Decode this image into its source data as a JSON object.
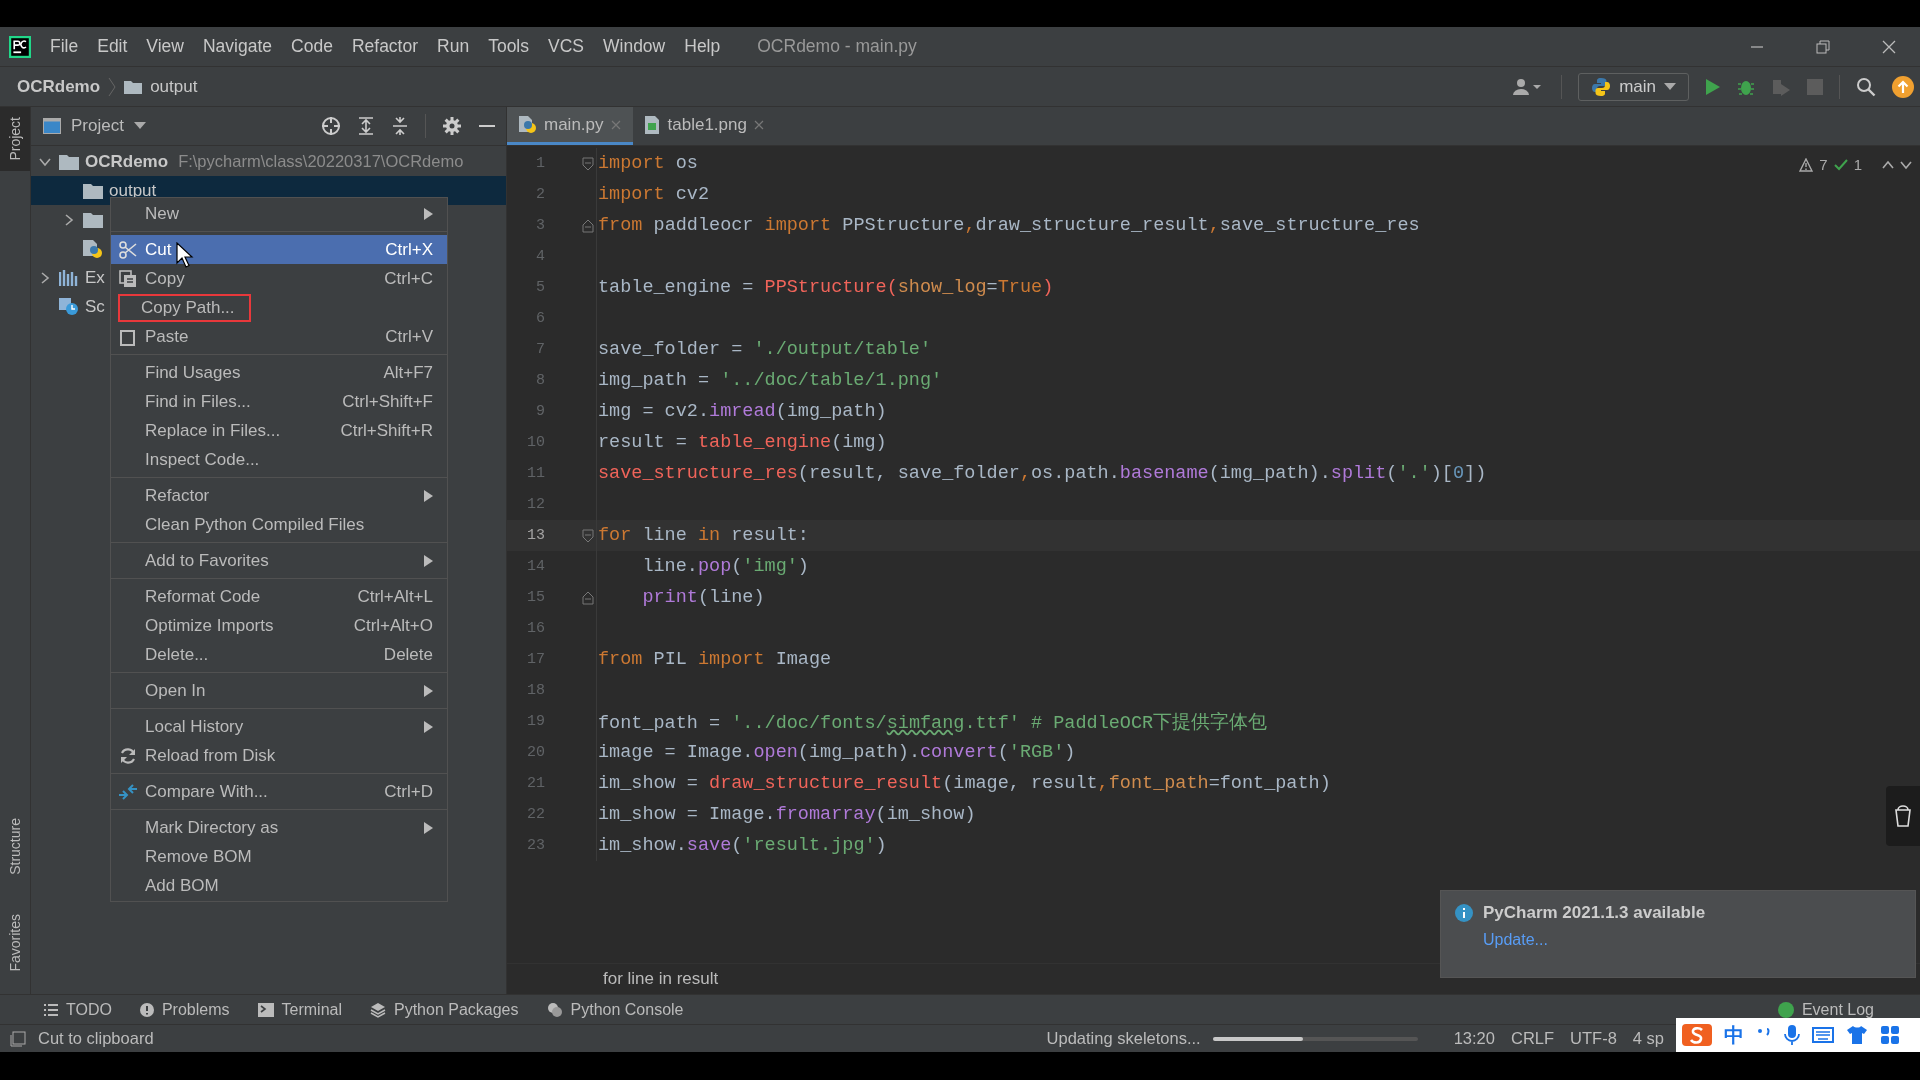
{
  "window": {
    "title": "OCRdemo - main.py"
  },
  "menu_bar": [
    {
      "label": "File"
    },
    {
      "label": "Edit"
    },
    {
      "label": "View"
    },
    {
      "label": "Navigate"
    },
    {
      "label": "Code"
    },
    {
      "label": "Refactor"
    },
    {
      "label": "Run"
    },
    {
      "label": "Tools"
    },
    {
      "label": "VCS"
    },
    {
      "label": "Window"
    },
    {
      "label": "Help"
    }
  ],
  "breadcrumb": [
    {
      "label": "OCRdemo",
      "kind": "project"
    },
    {
      "label": "output",
      "kind": "folder"
    }
  ],
  "run_config": {
    "label": "main"
  },
  "side_stripe": [
    {
      "label": "Project",
      "selected": true
    },
    {
      "label": "Structure",
      "selected": false
    },
    {
      "label": "Favorites",
      "selected": false
    }
  ],
  "project_panel": {
    "title": "Project",
    "tree": [
      {
        "kind": "folder",
        "label": "OCRdemo",
        "path": "F:\\pycharm\\class\\20220317\\OCRdemo",
        "expanded": true,
        "selected": false,
        "children": [
          {
            "kind": "folder",
            "label": "output",
            "selected": true
          },
          {
            "kind": "folder",
            "expanded": false,
            "selected": false
          },
          {
            "kind": "python",
            "selected": false
          }
        ]
      },
      {
        "kind": "libraries",
        "label": "Ex",
        "expanded": false,
        "selected": false
      },
      {
        "kind": "scratches",
        "label": "Sc",
        "selected": false
      }
    ]
  },
  "editor_tabs": [
    {
      "label": "main.py",
      "kind": "python",
      "selected": true
    },
    {
      "label": "table1.png",
      "kind": "image",
      "selected": false
    }
  ],
  "inspections": {
    "warnings": "7",
    "ok": "1"
  },
  "code": [
    {
      "n": "1",
      "fold_open": true,
      "tokens": [
        {
          "kind": "kw",
          "text": "import"
        },
        {
          "kind": "plain",
          "text": " os"
        }
      ]
    },
    {
      "n": "2",
      "tokens": [
        {
          "kind": "kw",
          "text": "import"
        },
        {
          "kind": "plain",
          "text": " cv2"
        }
      ]
    },
    {
      "n": "3",
      "fold_close": true,
      "tokens": [
        {
          "kind": "kw",
          "text": "from"
        },
        {
          "kind": "plain",
          "text": " paddleocr "
        },
        {
          "kind": "kw",
          "text": "import"
        },
        {
          "kind": "plain",
          "text": " PPStructure"
        },
        {
          "kind": "kw",
          "text": ","
        },
        {
          "kind": "plain",
          "text": "draw_structure_result"
        },
        {
          "kind": "kw",
          "text": ","
        },
        {
          "kind": "plain",
          "text": "save_structure_res"
        }
      ]
    },
    {
      "n": "4"
    },
    {
      "n": "5",
      "tokens": [
        {
          "kind": "plain",
          "text": "table_engine = "
        },
        {
          "kind": "fn",
          "text": "PPStructure("
        },
        {
          "kind": "param",
          "text": "show_log"
        },
        {
          "kind": "plain",
          "text": "="
        },
        {
          "kind": "kw",
          "text": "True"
        },
        {
          "kind": "fn",
          "text": ")"
        }
      ]
    },
    {
      "n": "6"
    },
    {
      "n": "7",
      "tokens": [
        {
          "kind": "plain",
          "text": "save_folder = "
        },
        {
          "kind": "str",
          "text": "'./output/table'"
        }
      ]
    },
    {
      "n": "8",
      "tokens": [
        {
          "kind": "plain",
          "text": "img_path = "
        },
        {
          "kind": "str",
          "text": "'../doc/table/1.png'"
        }
      ]
    },
    {
      "n": "9",
      "tokens": [
        {
          "kind": "plain",
          "text": "img = cv2."
        },
        {
          "kind": "call",
          "text": "imread"
        },
        {
          "kind": "plain",
          "text": "(img_path)"
        }
      ]
    },
    {
      "n": "10",
      "tokens": [
        {
          "kind": "plain",
          "text": "result = "
        },
        {
          "kind": "fn",
          "text": "table_engine"
        },
        {
          "kind": "plain",
          "text": "(img)"
        }
      ]
    },
    {
      "n": "11",
      "tokens": [
        {
          "kind": "fn",
          "text": "save_structure_res"
        },
        {
          "kind": "plain",
          "text": "(result, save_folder"
        },
        {
          "kind": "kw",
          "text": ","
        },
        {
          "kind": "plain",
          "text": "os.path."
        },
        {
          "kind": "call",
          "text": "basename"
        },
        {
          "kind": "plain",
          "text": "(img_path)."
        },
        {
          "kind": "call",
          "text": "split"
        },
        {
          "kind": "plain",
          "text": "("
        },
        {
          "kind": "str",
          "text": "'.'"
        },
        {
          "kind": "plain",
          "text": ")["
        },
        {
          "kind": "num",
          "text": "0"
        },
        {
          "kind": "plain",
          "text": "])"
        }
      ]
    },
    {
      "n": "12"
    },
    {
      "n": "13",
      "fold_open": true,
      "current": true,
      "tokens": [
        {
          "kind": "kw",
          "text": "for"
        },
        {
          "kind": "plain",
          "text": " line "
        },
        {
          "kind": "kw",
          "text": "in"
        },
        {
          "kind": "plain",
          "text": " result:"
        }
      ]
    },
    {
      "n": "14",
      "tokens": [
        {
          "kind": "plain",
          "text": "    line."
        },
        {
          "kind": "call",
          "text": "pop"
        },
        {
          "kind": "plain",
          "text": "("
        },
        {
          "kind": "str",
          "text": "'img'"
        },
        {
          "kind": "plain",
          "text": ")"
        }
      ]
    },
    {
      "n": "15",
      "fold_close": true,
      "tokens": [
        {
          "kind": "call",
          "text": "    print"
        },
        {
          "kind": "plain",
          "text": "(line)"
        }
      ]
    },
    {
      "n": "16"
    },
    {
      "n": "17",
      "tokens": [
        {
          "kind": "kw",
          "text": "from"
        },
        {
          "kind": "plain",
          "text": " PIL "
        },
        {
          "kind": "kw",
          "text": "import"
        },
        {
          "kind": "plain",
          "text": " Image"
        }
      ]
    },
    {
      "n": "18"
    },
    {
      "n": "19",
      "tokens": [
        {
          "kind": "plain",
          "text": "font_path = "
        },
        {
          "kind": "str",
          "text": "'../doc/fonts/"
        },
        {
          "kind": "typo",
          "text": "simfang"
        },
        {
          "kind": "str",
          "text": ".ttf' "
        },
        {
          "kind": "comment",
          "text": "# PaddleOCR下提供字体包"
        }
      ]
    },
    {
      "n": "20",
      "tokens": [
        {
          "kind": "plain",
          "text": "image = Image."
        },
        {
          "kind": "call",
          "text": "open"
        },
        {
          "kind": "plain",
          "text": "(img_path)."
        },
        {
          "kind": "call",
          "text": "convert"
        },
        {
          "kind": "plain",
          "text": "("
        },
        {
          "kind": "str",
          "text": "'RGB'"
        },
        {
          "kind": "plain",
          "text": ")"
        }
      ]
    },
    {
      "n": "21",
      "tokens": [
        {
          "kind": "plain",
          "text": "im_show = "
        },
        {
          "kind": "fn",
          "text": "draw_structure_result"
        },
        {
          "kind": "plain",
          "text": "(image, result"
        },
        {
          "kind": "kw",
          "text": ","
        },
        {
          "kind": "param",
          "text": "font_path"
        },
        {
          "kind": "plain",
          "text": "=font_path)"
        }
      ]
    },
    {
      "n": "22",
      "tokens": [
        {
          "kind": "plain",
          "text": "im_show = Image."
        },
        {
          "kind": "call",
          "text": "fromarray"
        },
        {
          "kind": "plain",
          "text": "(im_show)"
        }
      ]
    },
    {
      "n": "23",
      "tokens": [
        {
          "kind": "plain",
          "text": "im_show."
        },
        {
          "kind": "call",
          "text": "save"
        },
        {
          "kind": "plain",
          "text": "("
        },
        {
          "kind": "str",
          "text": "'result.jpg'"
        },
        {
          "kind": "plain",
          "text": ")"
        }
      ]
    }
  ],
  "editor_breadcrumb": "for line in result",
  "context_menu": {
    "groups": [
      {
        "items": [
          {
            "label": "New",
            "submenu": true,
            "selected": false,
            "highlighted": false
          }
        ]
      },
      {
        "items": [
          {
            "label": "Cut",
            "shortcut": "Ctrl+X",
            "submenu": false,
            "selected": true,
            "highlighted": false
          },
          {
            "label": "Copy",
            "shortcut": "Ctrl+C",
            "submenu": false,
            "selected": false,
            "highlighted": false
          },
          {
            "label": "Copy Path...",
            "submenu": false,
            "selected": false,
            "highlighted": true
          },
          {
            "label": "Paste",
            "shortcut": "Ctrl+V",
            "submenu": false,
            "selected": false,
            "highlighted": false
          }
        ]
      },
      {
        "items": [
          {
            "label": "Find Usages",
            "shortcut": "Alt+F7",
            "submenu": false,
            "selected": false,
            "highlighted": false
          },
          {
            "label": "Find in Files...",
            "shortcut": "Ctrl+Shift+F",
            "submenu": false,
            "selected": false,
            "highlighted": false
          },
          {
            "label": "Replace in Files...",
            "shortcut": "Ctrl+Shift+R",
            "submenu": false,
            "selected": false,
            "highlighted": false
          },
          {
            "label": "Inspect Code...",
            "submenu": false,
            "selected": false,
            "highlighted": false
          }
        ]
      },
      {
        "items": [
          {
            "label": "Refactor",
            "submenu": true,
            "selected": false,
            "highlighted": false
          },
          {
            "label": "Clean Python Compiled Files",
            "submenu": false,
            "selected": false,
            "highlighted": false
          }
        ]
      },
      {
        "items": [
          {
            "label": "Add to Favorites",
            "submenu": true,
            "selected": false,
            "highlighted": false
          }
        ]
      },
      {
        "items": [
          {
            "label": "Reformat Code",
            "shortcut": "Ctrl+Alt+L",
            "submenu": false,
            "selected": false,
            "highlighted": false
          },
          {
            "label": "Optimize Imports",
            "shortcut": "Ctrl+Alt+O",
            "submenu": false,
            "selected": false,
            "highlighted": false
          },
          {
            "label": "Delete...",
            "shortcut": "Delete",
            "submenu": false,
            "selected": false,
            "highlighted": false
          }
        ]
      },
      {
        "items": [
          {
            "label": "Open In",
            "submenu": true,
            "selected": false,
            "highlighted": false
          }
        ]
      },
      {
        "items": [
          {
            "label": "Local History",
            "submenu": true,
            "selected": false,
            "highlighted": false
          },
          {
            "label": "Reload from Disk",
            "submenu": false,
            "selected": false,
            "highlighted": false
          }
        ]
      },
      {
        "items": [
          {
            "label": "Compare With...",
            "shortcut": "Ctrl+D",
            "submenu": false,
            "selected": false,
            "highlighted": false
          }
        ]
      },
      {
        "items": [
          {
            "label": "Mark Directory as",
            "submenu": true,
            "selected": false,
            "highlighted": false
          },
          {
            "label": "Remove BOM",
            "submenu": false,
            "selected": false,
            "highlighted": false
          },
          {
            "label": "Add BOM",
            "submenu": false,
            "selected": false,
            "highlighted": false
          }
        ]
      }
    ]
  },
  "notification": {
    "title": "PyCharm 2021.1.3 available",
    "link": "Update..."
  },
  "tool_tabs": [
    {
      "label": "TODO",
      "kind": "list"
    },
    {
      "label": "Problems",
      "kind": "problems"
    },
    {
      "label": "Terminal",
      "kind": "terminal"
    },
    {
      "label": "Python Packages",
      "kind": "packages"
    },
    {
      "label": "Python Console",
      "kind": "console"
    }
  ],
  "event_log": "Event Log",
  "status_bar": {
    "message": "Cut to clipboard",
    "task": "Updating skeletons...",
    "level": 0.44,
    "position": "13:20",
    "line_sep": "CRLF",
    "encoding": "UTF-8",
    "indent": "4 sp"
  },
  "ime": {
    "mode": "中"
  }
}
